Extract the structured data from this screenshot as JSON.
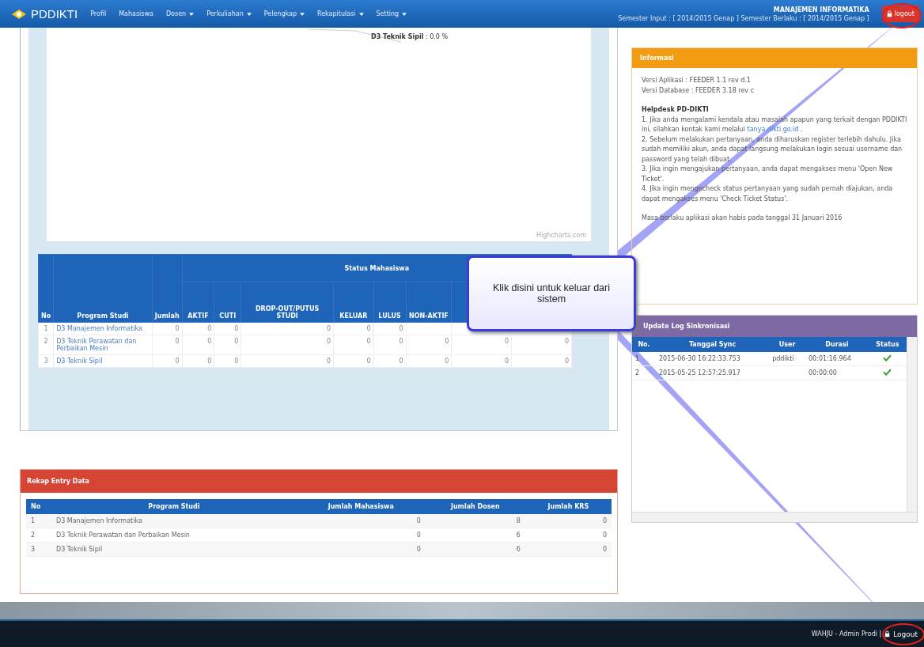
{
  "nav": {
    "brand": "PDDIKTI",
    "items": [
      {
        "label": "Profil",
        "dropdown": false
      },
      {
        "label": "Mahasiswa",
        "dropdown": false
      },
      {
        "label": "Dosen",
        "dropdown": true
      },
      {
        "label": "Perkuliahan",
        "dropdown": true
      },
      {
        "label": "Pelengkap",
        "dropdown": true
      },
      {
        "label": "Rekapitulasi",
        "dropdown": true
      },
      {
        "label": "Setting",
        "dropdown": true
      }
    ],
    "unit": "MANAJEMEN INFORMATIKA",
    "semester": "Semester Input : [ 2014/2015 Genap ] Semester Berlaku : [ 2014/2015 Genap ]",
    "logout": "logout"
  },
  "chart": {
    "label": "**D3 Teknik Sipil** : 0.0 %",
    "credit": "Highcharts.com"
  },
  "status_table": {
    "group": "Status Mahasiswa",
    "columns": [
      "No",
      "Program Studi",
      "Jumlah",
      "AKTIF",
      "CUTI",
      "DROP-OUT/PUTUS STUDI",
      "KELUAR",
      "LULUS",
      "NON-AKTIF"
    ],
    "rows": [
      {
        "no": "1",
        "program": "D3 Manajemen Informatika",
        "values": [
          "0",
          "0",
          "0",
          "0",
          "0",
          "0"
        ]
      },
      {
        "no": "2",
        "program": "D3 Teknik Perawatan dan Perbaikan Mesin",
        "values": [
          "0",
          "0",
          "0",
          "0",
          "0",
          "0",
          "0",
          "0",
          "0"
        ]
      },
      {
        "no": "3",
        "program": "D3 Teknik Sipil",
        "values": [
          "0",
          "0",
          "0",
          "0",
          "0",
          "0",
          "0",
          "0",
          "0"
        ]
      }
    ]
  },
  "rekap": {
    "title": "Rekap Entry Data",
    "columns": [
      "No",
      "Program Studi",
      "Jumlah Mahasiswa",
      "Jumlah Dosen",
      "Jumlah KRS"
    ],
    "rows": [
      [
        "1",
        "D3 Manajemen Informatika",
        "0",
        "8",
        "0"
      ],
      [
        "2",
        "D3 Teknik Perawatan dan Perbaikan Mesin",
        "0",
        "6",
        "0"
      ],
      [
        "3",
        "D3 Teknik Sipil",
        "0",
        "6",
        "0"
      ]
    ]
  },
  "info": {
    "title": "Informasi",
    "versions": [
      "Versi Aplikasi : FEEDER 1.1 rev d.1",
      "Versi Database : FEEDER 3.18 rev c"
    ],
    "helpdesk": "Helpdesk PD-DIKTI",
    "item1": "1. Jika anda mengalami kendala atau masalah apapun yang terkait dengan PDDIKTI ini, silahkan kontak kami melalui",
    "link": "tanya.dikti.go.id",
    "item1_end": ".",
    "items": [
      "2. Sebelum melakukan pertanyaan, anda diharuskan register terlebih dahulu. Jika sudah memiliki akun, anda dapat langsung melakukan login sesuai username dan password yang telah dibuat.",
      "3. Jika ingin mengajukan pertanyaan, anda dapat mengakses menu 'Open New Ticket'.",
      "4. Jika ingin mengecheck status pertanyaan yang sudah pernah diajukan, anda dapat mengakses menu 'Check Ticket Status'."
    ],
    "expiry": "Masa berlaku aplikasi akan habis pada tanggal 31 Januari 2016"
  },
  "sync_log": {
    "title": "Update Log Sinkronisasi",
    "columns": [
      "No.",
      "Tanggal Sync",
      "User",
      "Durasi",
      "Status"
    ],
    "rows": [
      {
        "no": "1",
        "date": "2015-06-30 16:22:33.753",
        "user": "pddikti",
        "duration": "00:01:16.964",
        "ok": true
      },
      {
        "no": "2",
        "date": "2015-05-25 12:57:25.917",
        "duration": "00:00:00",
        "ok": true
      }
    ]
  },
  "footer": {
    "user": "WAHJU - Admin Prodi |",
    "logout": "Logout"
  },
  "annotation": {
    "callout": "Klik disini untuk keluar dari sistem"
  }
}
